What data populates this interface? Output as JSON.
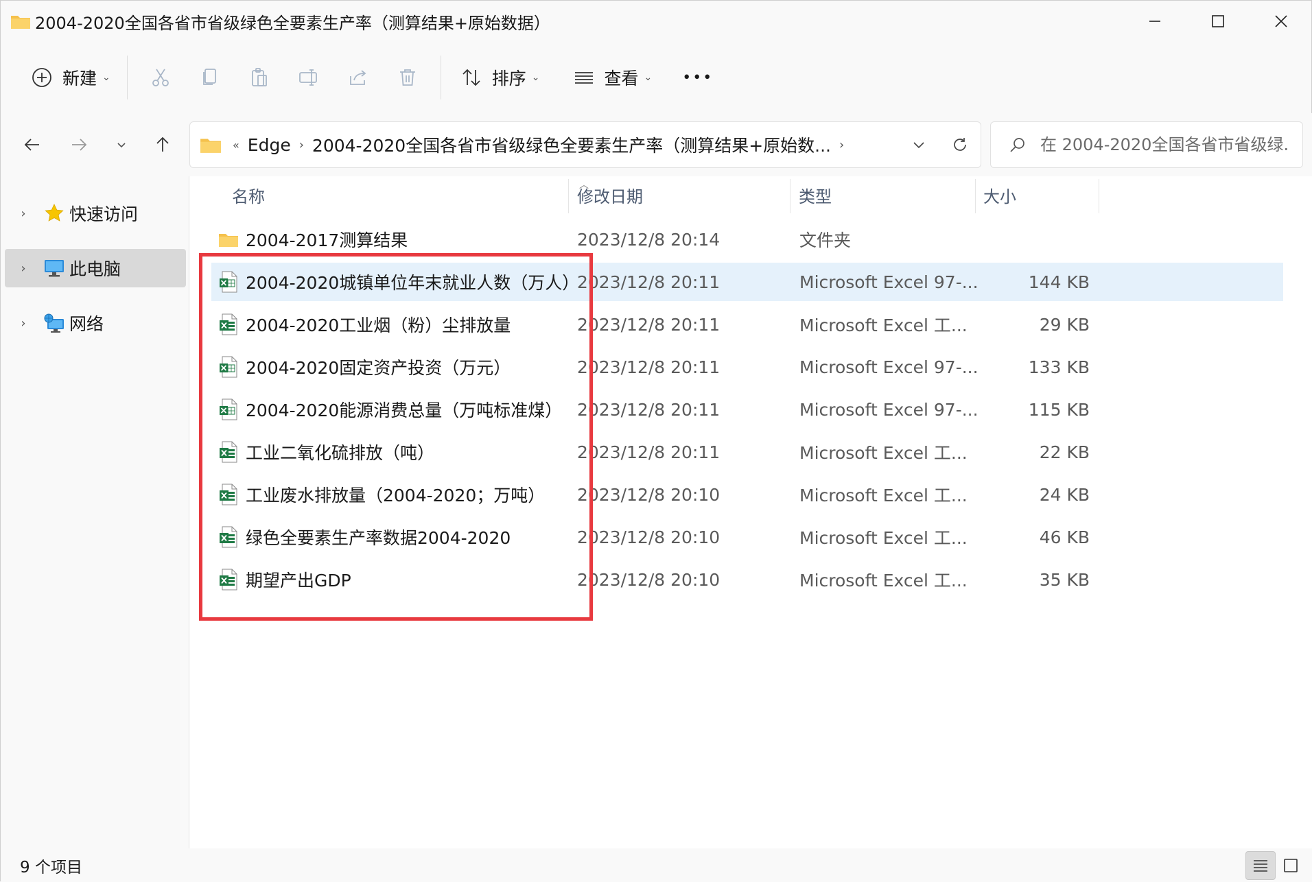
{
  "window": {
    "title": "2004-2020全国各省市省级绿色全要素生产率（测算结果+原始数据）"
  },
  "toolbar": {
    "new_label": "新建",
    "sort_label": "排序",
    "view_label": "查看",
    "more_label": "•••"
  },
  "address": {
    "overflow": "«",
    "segments": [
      "Edge",
      "2004-2020全国各省市省级绿色全要素生产率（测算结果+原始数..."
    ]
  },
  "search": {
    "placeholder": "在 2004-2020全国各省市省级绿..."
  },
  "sidebar": {
    "items": [
      {
        "label": "快速访问",
        "icon": "star-icon"
      },
      {
        "label": "此电脑",
        "icon": "computer-icon",
        "selected": true
      },
      {
        "label": "网络",
        "icon": "network-icon"
      }
    ]
  },
  "columns": {
    "name": "名称",
    "date": "修改日期",
    "type": "类型",
    "size": "大小"
  },
  "files": [
    {
      "name": "2004-2017测算结果",
      "date": "2023/12/8 20:14",
      "type": "文件夹",
      "size": "",
      "icon": "folder-icon"
    },
    {
      "name": "2004-2020城镇单位年末就业人数（万人）",
      "date": "2023/12/8 20:11",
      "type": "Microsoft Excel 97-...",
      "size": "144 KB",
      "icon": "excel-xls-icon",
      "selected": true
    },
    {
      "name": "2004-2020工业烟（粉）尘排放量",
      "date": "2023/12/8 20:11",
      "type": "Microsoft Excel 工...",
      "size": "29 KB",
      "icon": "excel-xlsx-icon"
    },
    {
      "name": "2004-2020固定资产投资（万元）",
      "date": "2023/12/8 20:11",
      "type": "Microsoft Excel 97-...",
      "size": "133 KB",
      "icon": "excel-xls-icon"
    },
    {
      "name": "2004-2020能源消费总量（万吨标准煤）",
      "date": "2023/12/8 20:11",
      "type": "Microsoft Excel 97-...",
      "size": "115 KB",
      "icon": "excel-xls-icon"
    },
    {
      "name": "工业二氧化硫排放（吨）",
      "date": "2023/12/8 20:11",
      "type": "Microsoft Excel 工...",
      "size": "22 KB",
      "icon": "excel-xlsx-icon"
    },
    {
      "name": "工业废水排放量（2004-2020；万吨）",
      "date": "2023/12/8 20:10",
      "type": "Microsoft Excel 工...",
      "size": "24 KB",
      "icon": "excel-xlsx-icon"
    },
    {
      "name": "绿色全要素生产率数据2004-2020",
      "date": "2023/12/8 20:10",
      "type": "Microsoft Excel 工...",
      "size": "46 KB",
      "icon": "excel-xlsx-icon"
    },
    {
      "name": "期望产出GDP",
      "date": "2023/12/8 20:10",
      "type": "Microsoft Excel 工...",
      "size": "35 KB",
      "icon": "excel-xlsx-icon"
    }
  ],
  "status": {
    "item_count": "9 个项目"
  },
  "colors": {
    "highlight": "#e8393f",
    "selection": "#e5f1fb",
    "folder": "#f5c14c",
    "excel": "#1f7a45"
  }
}
